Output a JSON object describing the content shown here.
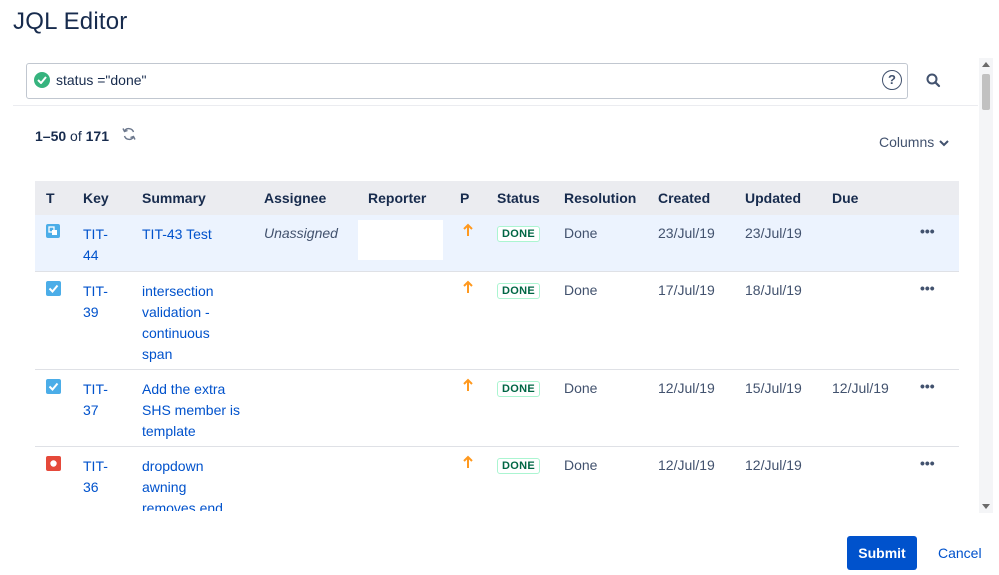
{
  "dialog": {
    "title": "JQL Editor"
  },
  "search": {
    "query": "status =\"done\"",
    "help_symbol": "?"
  },
  "pagination": {
    "range": "1–50",
    "of_text": "of",
    "total": "171"
  },
  "columns_label": "Columns",
  "table": {
    "headers": [
      "T",
      "Key",
      "Summary",
      "Assignee",
      "Reporter",
      "P",
      "Status",
      "Resolution",
      "Created",
      "Updated",
      "Due"
    ],
    "rows": [
      {
        "type_icon": "subtask-icon",
        "key_line1": "TIT-",
        "key_line2": "44",
        "summary_lines": [
          "TIT-43 Test"
        ],
        "assignee": "Unassigned",
        "reporter": "",
        "priority_icon": "priority-arrow-up-icon",
        "status": "DONE",
        "resolution": "Done",
        "created": "23/Jul/19",
        "updated": "23/Jul/19",
        "due": ""
      },
      {
        "type_icon": "task-icon",
        "key_line1": "TIT-",
        "key_line2": "39",
        "summary_lines": [
          "intersection",
          "validation -",
          "continuous",
          "span"
        ],
        "assignee": "",
        "reporter": "",
        "priority_icon": "priority-arrow-up-icon",
        "status": "DONE",
        "resolution": "Done",
        "created": "17/Jul/19",
        "updated": "18/Jul/19",
        "due": ""
      },
      {
        "type_icon": "task-icon",
        "key_line1": "TIT-",
        "key_line2": "37",
        "summary_lines": [
          "Add the extra",
          "SHS member is",
          "template"
        ],
        "assignee": "",
        "reporter": "",
        "priority_icon": "priority-arrow-up-icon",
        "status": "DONE",
        "resolution": "Done",
        "created": "12/Jul/19",
        "updated": "15/Jul/19",
        "due": "12/Jul/19"
      },
      {
        "type_icon": "bug-icon",
        "key_line1": "TIT-",
        "key_line2": "36",
        "summary_lines": [
          "dropdown",
          "awning",
          "removes end"
        ],
        "assignee": "",
        "reporter": "",
        "priority_icon": "priority-arrow-up-icon",
        "status": "DONE",
        "resolution": "Done",
        "created": "12/Jul/19",
        "updated": "12/Jul/19",
        "due": ""
      }
    ]
  },
  "footer": {
    "submit_label": "Submit",
    "cancel_label": "Cancel"
  },
  "colors": {
    "link": "#0052cc",
    "done_lozenge_text": "#006644",
    "priority_high": "#ff991f",
    "task_icon": "#4bade8",
    "bug_icon": "#e5493a",
    "submit_bg": "#0052cc",
    "header_bg": "#ebecf0"
  }
}
